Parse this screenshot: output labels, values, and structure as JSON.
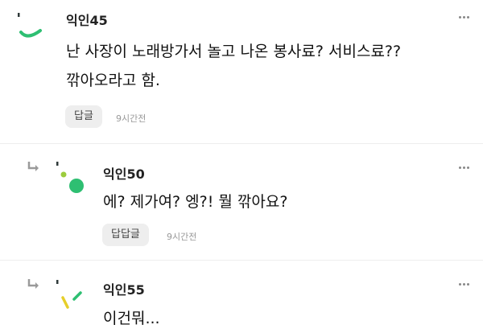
{
  "comments": [
    {
      "user": "익인45",
      "body_lines": [
        "난 사장이 노래방가서 놀고 나온 봉사료? 서비스료??",
        "깎아오라고 함."
      ],
      "reply_label": "답글",
      "time": "9시간전"
    },
    {
      "user": "익인50",
      "body_lines": [
        "에? 제가여? 엥?! 뭘 깎아요?"
      ],
      "reply_label": "답답글",
      "time": "9시간전"
    },
    {
      "user": "익인55",
      "body_lines": [
        "이건뭐..."
      ]
    }
  ],
  "colors": {
    "avatar_green": "#2ebf72",
    "avatar_lime": "#9ccc3d",
    "avatar_yellow": "#e6cf2a",
    "avatar_dark": "#2f3a3a"
  },
  "icons": {
    "reply_indicator": "reply-arrow-icon",
    "more": "more-options-icon"
  }
}
